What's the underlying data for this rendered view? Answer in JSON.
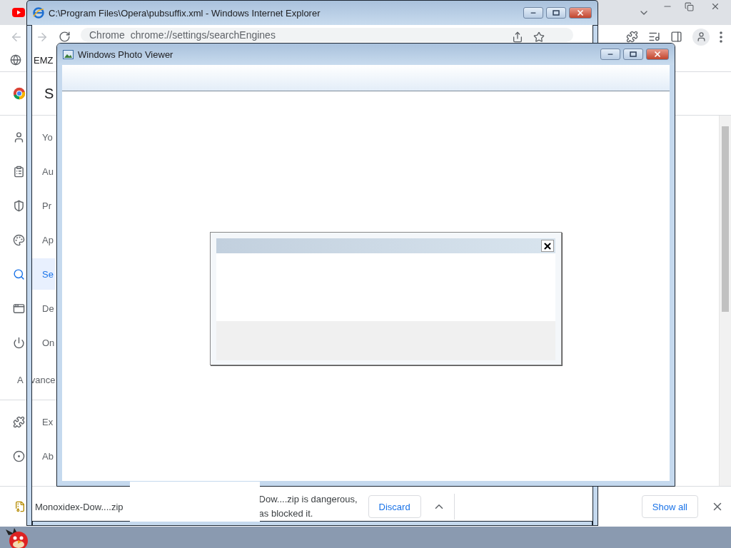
{
  "chrome": {
    "omnibox": {
      "site_label": "Chrome",
      "url": "chrome://settings/searchEngines"
    },
    "bookmarks": [
      {
        "label": "EMZ"
      }
    ],
    "page_title": "S",
    "sidebar": {
      "items": [
        {
          "kind": "you",
          "label": "Yo",
          "selected": false
        },
        {
          "kind": "autofill",
          "label": "Au",
          "selected": false
        },
        {
          "kind": "privacy",
          "label": "Pr",
          "selected": false
        },
        {
          "kind": "appearance",
          "label": "Ap",
          "selected": false
        },
        {
          "kind": "search",
          "label": "Se",
          "selected": true
        },
        {
          "kind": "browser",
          "label": "De",
          "selected": false
        },
        {
          "kind": "startup",
          "label": "On",
          "selected": false
        }
      ],
      "advanced": [
        "A",
        "vance"
      ],
      "extra_items": [
        {
          "kind": "extensions",
          "label": "Ex"
        },
        {
          "kind": "about",
          "label": "Ab"
        }
      ]
    },
    "download_bar": {
      "file": "Monoxidex-Dow....zip",
      "warning_lines": [
        "Dow....zip is dangerous,",
        "as blocked it."
      ],
      "discard": "Discard",
      "show_all": "Show all"
    }
  },
  "ie_window": {
    "title": "C:\\Program Files\\Opera\\pubsuffix.xml - Windows Internet Explorer"
  },
  "photo_viewer": {
    "title": "Windows Photo Viewer"
  }
}
